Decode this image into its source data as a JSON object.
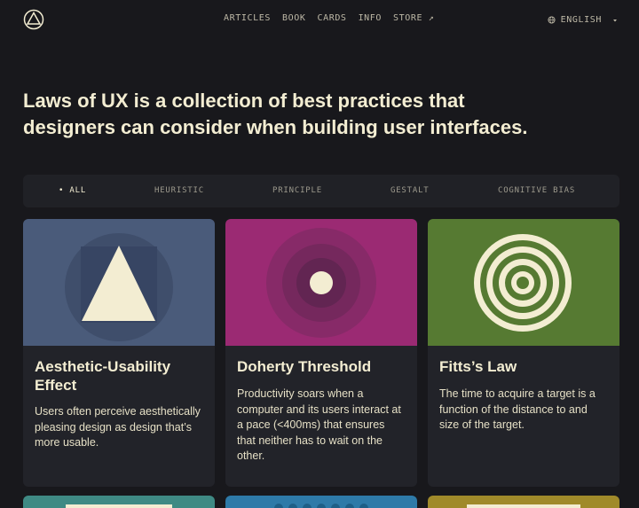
{
  "nav": {
    "links": [
      {
        "label": "ARTICLES"
      },
      {
        "label": "BOOK"
      },
      {
        "label": "CARDS"
      },
      {
        "label": "INFO"
      },
      {
        "label": "STORE ↗"
      }
    ],
    "language": "ENGLISH"
  },
  "hero": {
    "text": "Laws of UX is a collection of best practices that designers can consider when building user interfaces."
  },
  "filters": [
    {
      "label": "• ALL",
      "active": true
    },
    {
      "label": "HEURISTIC"
    },
    {
      "label": "PRINCIPLE"
    },
    {
      "label": "GESTALT"
    },
    {
      "label": "COGNITIVE BIAS"
    }
  ],
  "cards": [
    {
      "title": "Aesthetic-Usability Effect",
      "description": "Users often perceive aesthetically pleasing design as design that’s more usable.",
      "color": "#4a5b7a",
      "icon": "triangle-in-circle-icon"
    },
    {
      "title": "Doherty Threshold",
      "description": "Productivity soars when a computer and its users interact at a pace (<400ms) that ensures that neither has to wait on the other.",
      "color": "#9b2a73",
      "icon": "concentric-circles-icon"
    },
    {
      "title": "Fitts’s Law",
      "description": "The time to acquire a target is a function of the distance to and size of the target.",
      "color": "#567a32",
      "icon": "target-icon"
    }
  ],
  "next_row_colors": [
    "#3f8a84",
    "#2e7aa8",
    "#a08a2a"
  ]
}
